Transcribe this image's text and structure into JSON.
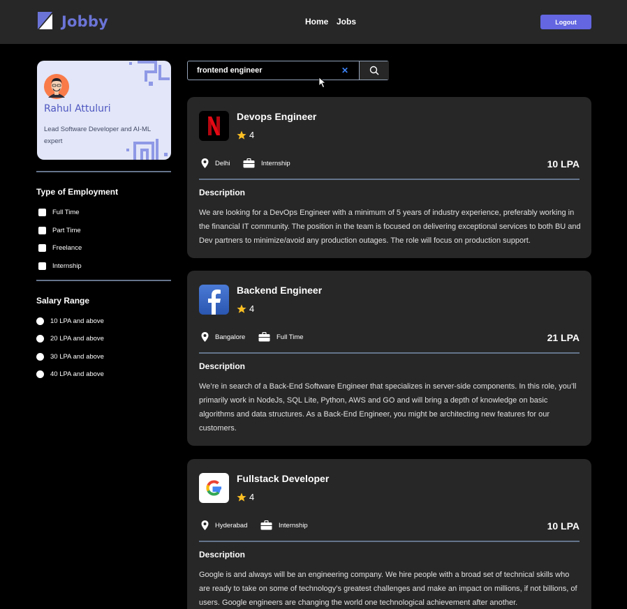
{
  "header": {
    "brand": "Jobby",
    "nav": {
      "home": "Home",
      "jobs": "Jobs"
    },
    "logout_label": "Logout"
  },
  "profile": {
    "name": "Rahul Attuluri",
    "bio": "Lead Software Developer and AI-ML expert"
  },
  "filters": {
    "employment_title": "Type of Employment",
    "employment_options": [
      "Full Time",
      "Part Time",
      "Freelance",
      "Internship"
    ],
    "salary_title": "Salary Range",
    "salary_options": [
      "10 LPA and above",
      "20 LPA and above",
      "30 LPA and above",
      "40 LPA and above"
    ]
  },
  "search": {
    "value": "frontend engineer",
    "clear_icon": "close-icon",
    "button_icon": "search-icon"
  },
  "jobs": [
    {
      "company_icon": "netflix-logo",
      "title": "Devops Engineer",
      "rating": "4",
      "location": "Delhi",
      "employment_type": "Internship",
      "package": "10 LPA",
      "description_label": "Description",
      "description": "We are looking for a DevOps Engineer with a minimum of 5 years of industry experience, preferably working in the financial IT community. The position in the team is focused on delivering exceptional services to both BU and Dev partners to minimize/avoid any production outages. The role will focus on production support."
    },
    {
      "company_icon": "facebook-logo",
      "title": "Backend Engineer",
      "rating": "4",
      "location": "Bangalore",
      "employment_type": "Full Time",
      "package": "21 LPA",
      "description_label": "Description",
      "description": "We’re in search of a Back-End Software Engineer that specializes in server-side components. In this role, you’ll primarily work in NodeJs, SQL Lite, Python, AWS and GO and will bring a depth of knowledge on basic algorithms and data structures. As a Back-End Engineer, you might be architecting new features for our customers."
    },
    {
      "company_icon": "google-logo",
      "title": "Fullstack Developer",
      "rating": "4",
      "location": "Hyderabad",
      "employment_type": "Internship",
      "package": "10 LPA",
      "description_label": "Description",
      "description": "Google is and always will be an engineering company. We hire people with a broad set of technical skills who are ready to take on some of technology’s greatest challenges and make an impact on millions, if not billions, of users. Google engineers are changing the world one technological achievement after another."
    }
  ],
  "colors": {
    "accent": "#6366e0",
    "brand": "#6b74d6",
    "card_bg": "#272727",
    "star": "#fbbf24",
    "clear_icon": "#3b82f6"
  }
}
